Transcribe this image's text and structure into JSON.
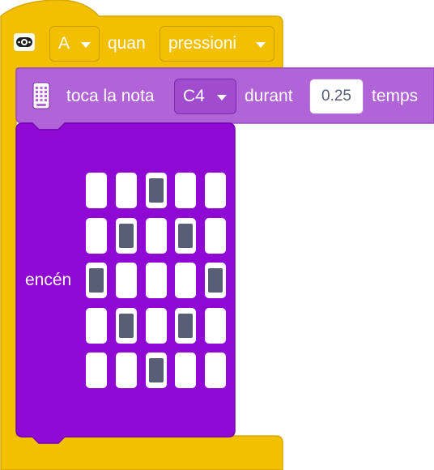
{
  "hat_block": {
    "icon": "microbit-button-icon",
    "button_value": "A",
    "label": "quan",
    "event_value": "pressioni",
    "color": "#f2c000"
  },
  "play_block": {
    "icon": "microbit-icon",
    "label_before": "toca la nota",
    "note_value": "C4",
    "label_mid": "durant",
    "duration_value": "0.25",
    "label_after": "temps",
    "color": "#b163d8"
  },
  "display_block": {
    "label": "encén",
    "color": "#8f08d4",
    "grid": [
      [
        0,
        0,
        1,
        0,
        0
      ],
      [
        0,
        1,
        0,
        1,
        0
      ],
      [
        1,
        0,
        0,
        0,
        1
      ],
      [
        0,
        1,
        0,
        1,
        0
      ],
      [
        0,
        0,
        1,
        0,
        0
      ]
    ]
  }
}
